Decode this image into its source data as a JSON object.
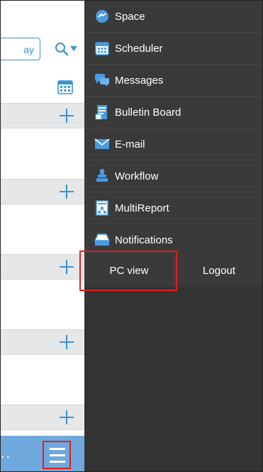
{
  "background_app": {
    "day_button_label": "ay",
    "footer_dots": "..",
    "colors": {
      "accent": "#3a93d1",
      "footer": "#6fa8dc",
      "section_header": "#e6e7e8"
    }
  },
  "menu": {
    "items": [
      {
        "label": "Space",
        "icon": "space-icon"
      },
      {
        "label": "Scheduler",
        "icon": "calendar-icon"
      },
      {
        "label": "Messages",
        "icon": "messages-icon"
      },
      {
        "label": "Bulletin Board",
        "icon": "bulletin-board-icon"
      },
      {
        "label": "E-mail",
        "icon": "email-icon"
      },
      {
        "label": "Workflow",
        "icon": "workflow-icon"
      },
      {
        "label": "MultiReport",
        "icon": "multireport-icon"
      },
      {
        "label": "Notifications",
        "icon": "notifications-icon"
      }
    ],
    "pc_view_label": "PC view",
    "logout_label": "Logout",
    "colors": {
      "menu_bg": "#333333",
      "item_bg": "#3a3a3a",
      "highlight": "#e21e1e",
      "icon": "#3a93d1"
    }
  }
}
